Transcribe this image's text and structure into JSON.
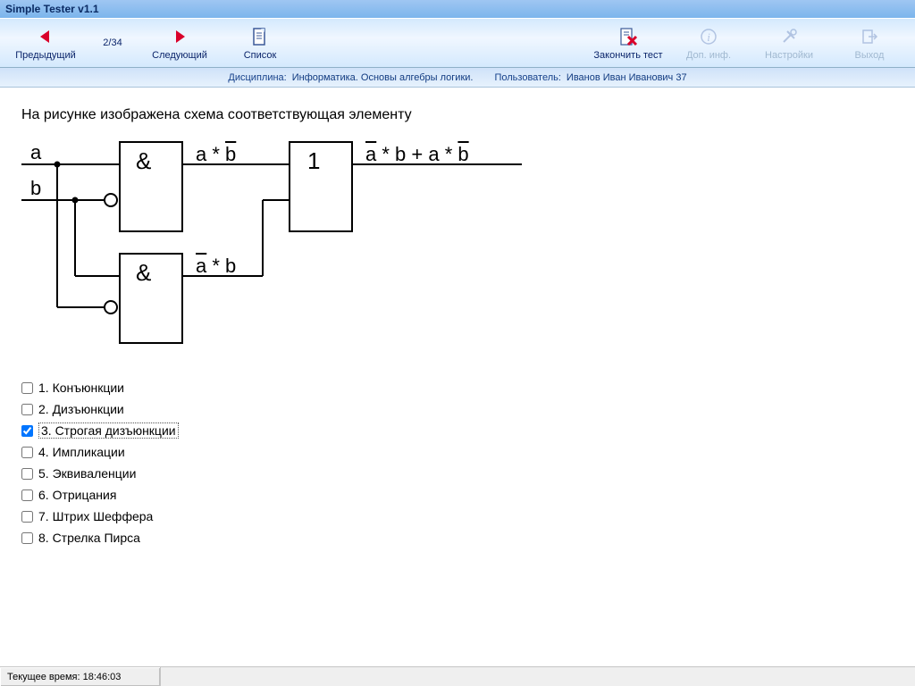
{
  "window": {
    "title": "Simple Tester v1.1"
  },
  "toolbar": {
    "prev": {
      "label": "Предыдущий"
    },
    "counter": "2/34",
    "next": {
      "label": "Следующий"
    },
    "list": {
      "label": "Список"
    },
    "finish": {
      "label": "Закончить тест"
    },
    "info": {
      "label": "Доп. инф."
    },
    "settings": {
      "label": "Настройки"
    },
    "exit": {
      "label": "Выход"
    }
  },
  "infobar": {
    "discipline_label": "Дисциплина:",
    "discipline_value": "Информатика. Основы алгебры логики.",
    "user_label": "Пользователь:",
    "user_value": "Иванов Иван Иванович  37"
  },
  "question": {
    "text": "На рисунке изображена схема соответствующая элементу"
  },
  "diagram": {
    "inputs": {
      "a": "a",
      "b": "b"
    },
    "gate_and1": "&",
    "gate_and2": "&",
    "gate_or": "1",
    "out1_plain": "a * ",
    "out1_over": "b",
    "out2_over": "a",
    "out2_plain": " * b",
    "final_1_over": "a",
    "final_1_plain": " * b + a * ",
    "final_2_over": "b"
  },
  "answers": [
    {
      "n": "1.",
      "text": "Конъюнкции",
      "checked": false
    },
    {
      "n": "2.",
      "text": "Дизъюнкции",
      "checked": false
    },
    {
      "n": "3.",
      "text": "Строгая дизъюнкции",
      "checked": true
    },
    {
      "n": "4.",
      "text": "Импликации",
      "checked": false
    },
    {
      "n": "5.",
      "text": "Эквиваленции",
      "checked": false
    },
    {
      "n": "6.",
      "text": "Отрицания",
      "checked": false
    },
    {
      "n": "7.",
      "text": "Штрих Шеффера",
      "checked": false
    },
    {
      "n": "8.",
      "text": "Стрелка Пирса",
      "checked": false
    }
  ],
  "statusbar": {
    "time_label": "Текущее время:",
    "time_value": "18:46:03"
  }
}
